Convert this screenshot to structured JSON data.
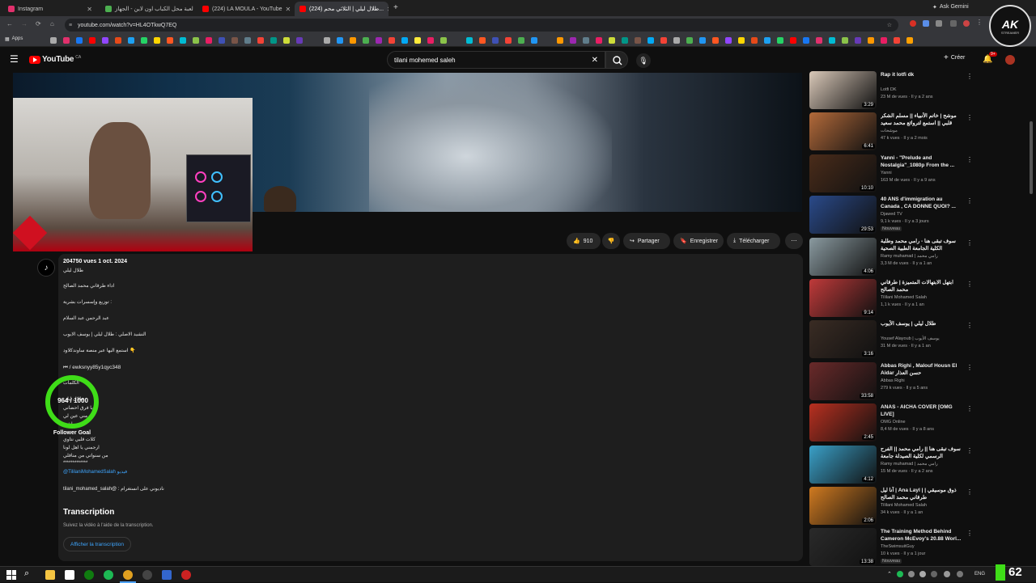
{
  "browser": {
    "tabs": [
      {
        "label": "Instagram",
        "color": "#e1306c"
      },
      {
        "label": "لعبة محل الكباب اون لاين - الجهاز",
        "color": "#4caf50"
      },
      {
        "label": "(224) LA MOULA - YouTube",
        "color": "#ff0000"
      },
      {
        "label": "(224) طلال ليلي | الثلاثي محم...",
        "color": "#ff0000"
      }
    ],
    "ask_gemini": "Ask Gemini",
    "url": "youtube.com/watch?v=HL4OTkwQ7EQ",
    "apps_label": "Apps"
  },
  "youtube": {
    "logo_text": "YouTube",
    "country": "CA",
    "search_value": "tilani mohemed saleh",
    "create_label": "Créer",
    "notif_count": "9+"
  },
  "actions": {
    "likes": "910",
    "share": "Partager",
    "save": "Enregistrer",
    "download": "Télécharger"
  },
  "description": {
    "stats": "204750 vues  1 oct. 2024",
    "lines": [
      "طلال ليلي",
      "اداء طرقاني محمد الصالح",
      "توزيع وإسسرات بشرية :",
      "عبد الرحمن عبد السلام",
      "النشيد الاصلي : طلال ليلي | يوسف الايوب",
      "استمع اليها عبر منصة ساوندكلاود 👇",
      "⏮ / ewksnyy85y1qyc348",
      "@TililaniMohamedSalah فيديو",
      "tilani_mohamed_salah@ : ناديوني على انستغرام"
    ],
    "lyrics": [
      "الكلمات",
      "طلال ليلي",
      "يا فرق احضاني",
      "مني عين لي",
      "ماشي",
      "كلات قلبي نتاوي",
      "ارجمني يا اهل لونا",
      "من سنواتي من مناقلي",
      "*************"
    ],
    "transcript_title": "Transcription",
    "transcript_sub": "Suivez la vidéo à l'aide de la transcription.",
    "transcript_btn": "Afficher la transcription"
  },
  "overlay": {
    "goal_value": "964 / 1000",
    "goal_label": "Follower Goal",
    "brand": "AK",
    "brand_sub": "STREAMER",
    "corner_num": "62"
  },
  "recommendations": [
    {
      "title": "Rap it lotfi dk",
      "channel": "Lotfi DK",
      "meta": "23 M de vues · Il y a 2 ans",
      "duration": "3:29",
      "color": "#d9c8b8"
    },
    {
      "title": "موشح | خاتم الأنبياء || مسلم الشكر قلبي || استمع لتروائع محمد سعيد الحجوني",
      "channel": "موشحات",
      "meta": "47 k vues · Il y a 2 mois",
      "duration": "6:41",
      "color": "#b36a3a"
    },
    {
      "title": "Yanni - \"Prelude and Nostalgia\"_1080p From the ...",
      "channel": "Yanni",
      "meta": "163 M de vues · Il y a 9 ans",
      "duration": "10:10",
      "color": "#4a2c1a"
    },
    {
      "title": "40 ANS d'immigration au Canada , CA DONNE QUOI? ...",
      "channel": "Djawed TV",
      "meta": "9,1 k vues · Il y a 3 jours",
      "badge": "Nouveau",
      "duration": "29:53",
      "color": "#2a4a8a"
    },
    {
      "title": "سوف تبقى هنا - رامي محمد وطلبة الكلية الجامعة الطبية الصحية الفلسطين ...",
      "channel": "Ramy muhamad | رامي محمد",
      "meta": "3,3 M de vues · Il y a 1 an",
      "duration": "4:06",
      "color": "#8a9aa0"
    },
    {
      "title": "ابتهل الابتهالات المتميزة | طرقاني محمد الصالح",
      "channel": "Tililani Mohamed Salah",
      "meta": "1,1 k vues · Il y a 1 an",
      "duration": "9:14",
      "color": "#c03a3a"
    },
    {
      "title": "طلال ليلي | يوسف الأيوب",
      "channel": "Yousef Alayoub | يوسف الأيوب",
      "meta": "31 M de vues · Il y a 1 an",
      "duration": "3:16",
      "color": "#3a2c24"
    },
    {
      "title": "Abbas Righi , Malouf Housn El Aidar حسن العذار",
      "channel": "Abbas Righi",
      "meta": "279 k vues · Il y a 5 ans",
      "duration": "33:58",
      "color": "#6a2a2a"
    },
    {
      "title": "ANAS - AICHA COVER [OMG LIVE]",
      "channel": "OMG Online",
      "meta": "8,4 M de vues · Il y a 8 ans",
      "duration": "2:45",
      "color": "#b83020"
    },
    {
      "title": "سوف تبقى هنا || رامي محمد || الفرح الرسمي لكلية الصيدلة جامعة الزهراوي ||",
      "channel": "Ramy muhamad | رامي محمد",
      "meta": "15 M de vues · Il y a 2 ans",
      "duration": "4:12",
      "color": "#3aa0c8"
    },
    {
      "title": "آنا ليل | Ana Layl | ذوق موسيقي | طرقاني محمد الصالح",
      "channel": "Tililani Mohamed Salah",
      "meta": "34 k vues · Il y a 1 an",
      "duration": "2:06",
      "color": "#d07a20"
    },
    {
      "title": "The Training Method Behind Cameron McEvoy's 20.88 Worl...",
      "channel": "TheSwimsuitGuy",
      "meta": "10 k vues · Il y a 1 jour",
      "badge": "Nouveau",
      "duration": "13:38",
      "color": "#2a2a2a"
    }
  ],
  "taskbar": {
    "lang": "ENG"
  }
}
